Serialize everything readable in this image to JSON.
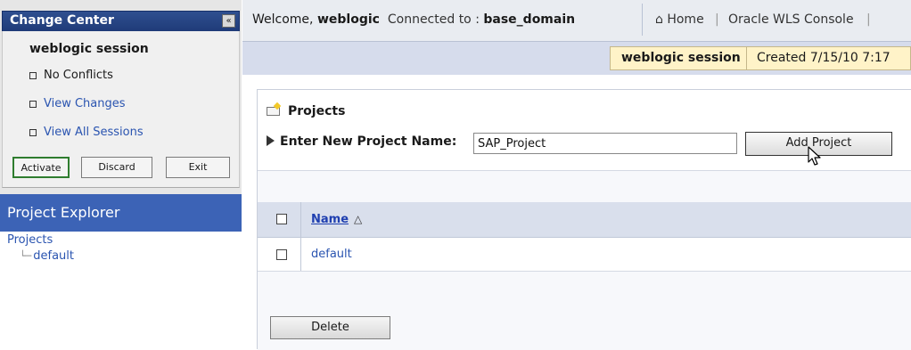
{
  "change_center": {
    "title": "Change Center",
    "collapse_glyph": "«",
    "session_title": "weblogic session",
    "status": "No Conflicts",
    "links": [
      "View Changes",
      "View All Sessions"
    ],
    "buttons": {
      "activate": "Activate",
      "discard": "Discard",
      "exit": "Exit"
    }
  },
  "project_explorer": {
    "title": "Project Explorer",
    "root": "Projects",
    "tree_connector": "└─",
    "child": "default"
  },
  "header": {
    "welcome_prefix": "Welcome,",
    "user": "weblogic",
    "connected_prefix": "Connected to :",
    "domain": "base_domain",
    "home_label": "Home",
    "home_icon": "home-icon",
    "console_label": "Oracle WLS Console",
    "separator": "|"
  },
  "session_bar": {
    "session_name": "weblogic session",
    "created": "Created 7/15/10 7:17"
  },
  "projects_panel": {
    "title": "Projects",
    "new_project_label": "Enter New Project Name:",
    "new_project_value": "SAP_Project",
    "add_button": "Add Project",
    "table": {
      "column_name": "Name",
      "sort_glyph": "△",
      "rows": [
        "default"
      ]
    },
    "delete_button": "Delete"
  },
  "colors": {
    "header_blue": "#2f4f90",
    "explorer_blue": "#3c63b6",
    "link_blue": "#2a54b0",
    "activate_border": "#2f7d2f",
    "session_yellow": "#fff3c8"
  }
}
